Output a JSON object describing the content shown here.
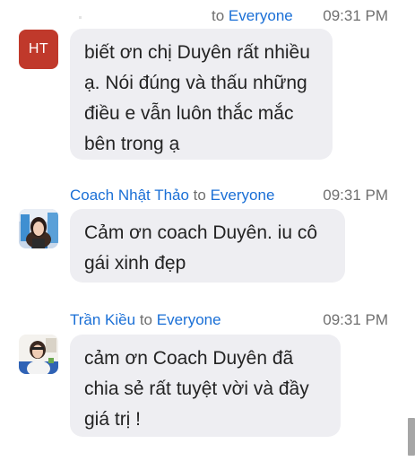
{
  "messages": [
    {
      "sender": "",
      "to_label": "to",
      "recipient": "Everyone",
      "time": "09:31 PM",
      "avatar_initials": "HT",
      "text": "biết ơn chị Duyên rất nhiều ạ. Nói đúng và thấu những điều e vẫn luôn thắc mắc bên trong ạ"
    },
    {
      "sender": "Coach Nhật Thảo",
      "to_label": "to",
      "recipient": "Everyone",
      "time": "09:31 PM",
      "avatar_initials": "",
      "text": "Cảm ơn coach Duyên. iu cô gái xinh đẹp"
    },
    {
      "sender": "Trần Kiều",
      "to_label": "to",
      "recipient": "Everyone",
      "time": "09:31 PM",
      "avatar_initials": "",
      "text": "cảm ơn Coach Duyên đã chia sẻ rất tuyệt vời và đầy giá trị !"
    }
  ],
  "colors": {
    "link_blue": "#1a6fd6",
    "timestamp_gray": "#6f6f6f",
    "bubble_bg": "#eeeef2",
    "avatar_ht_bg": "#c0392b"
  },
  "icons": {
    "avatar_2": "profile-photo-icon",
    "avatar_3": "profile-photo-icon"
  }
}
